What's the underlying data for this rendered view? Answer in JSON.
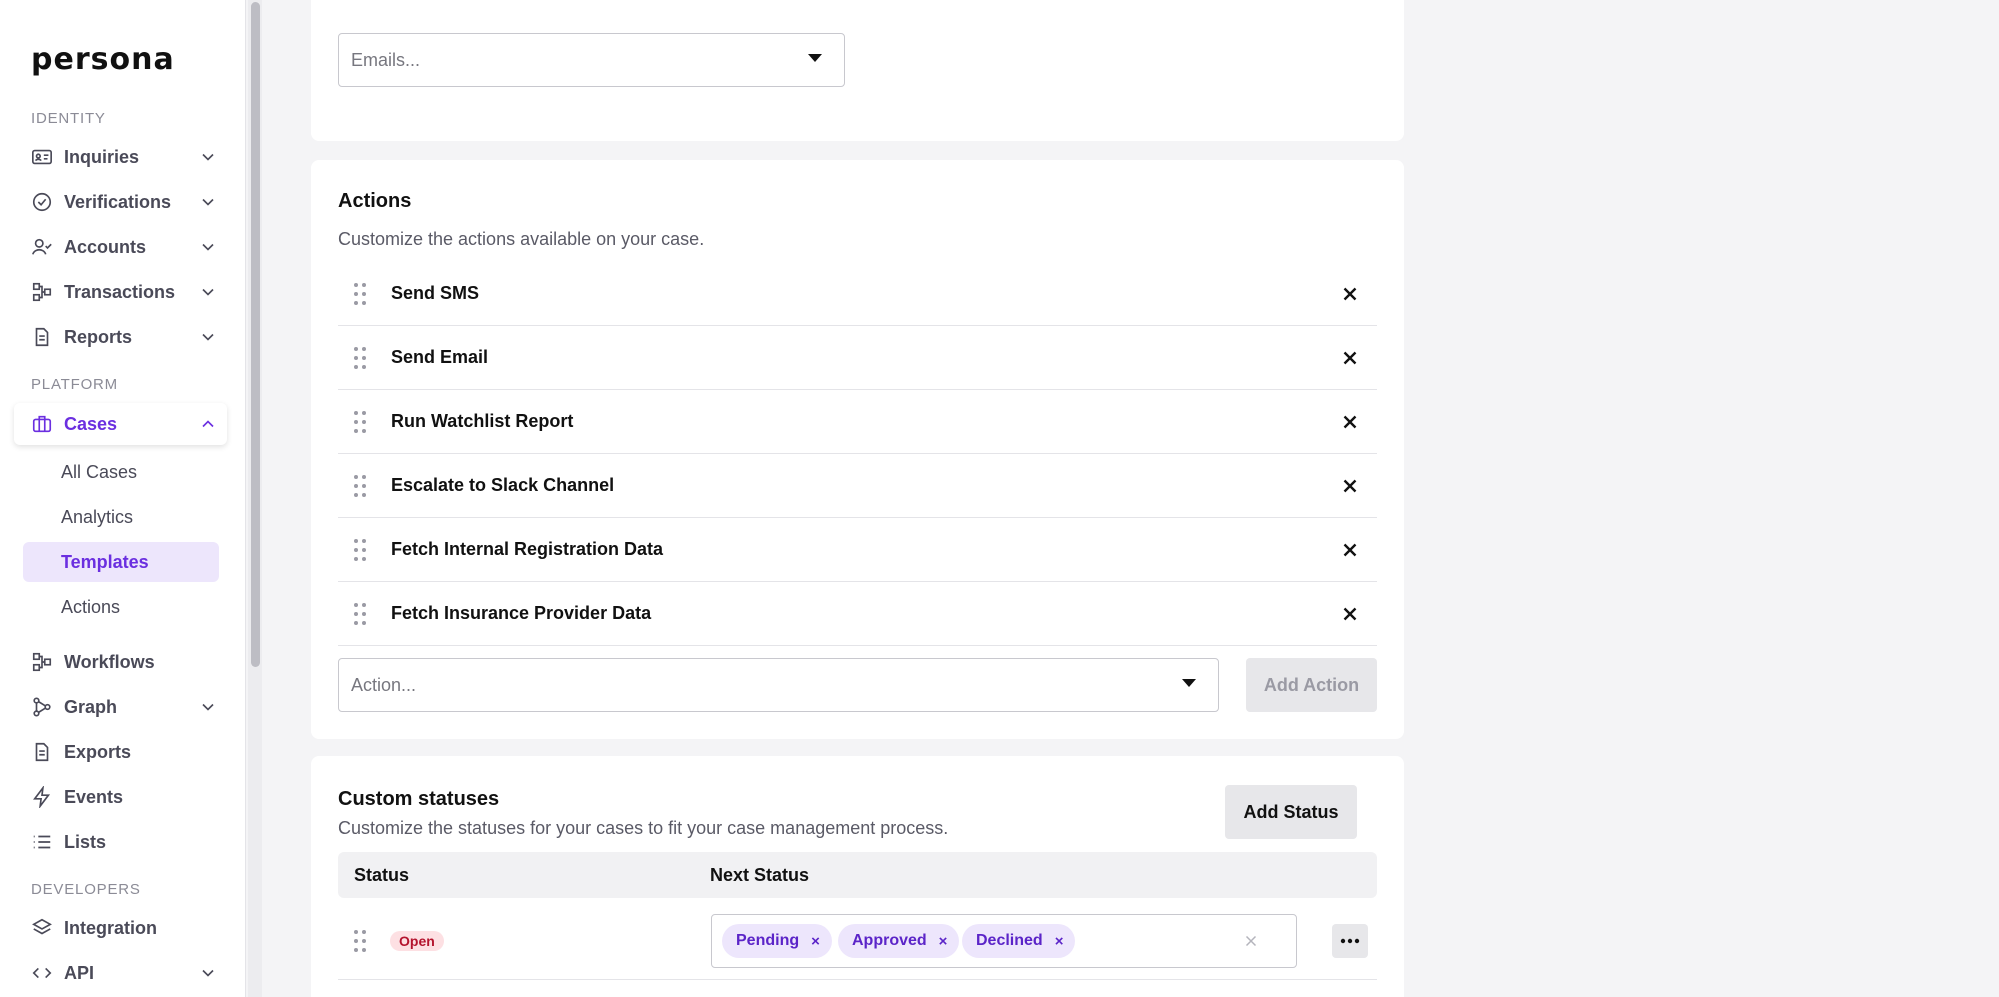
{
  "brand": {
    "logo_text": "persona"
  },
  "sidebar": {
    "sections": {
      "identity": "IDENTITY",
      "platform": "PLATFORM",
      "developers": "DEVELOPERS"
    },
    "items": {
      "inquiries": "Inquiries",
      "verifications": "Verifications",
      "accounts": "Accounts",
      "transactions": "Transactions",
      "reports": "Reports",
      "cases": "Cases",
      "workflows": "Workflows",
      "graph": "Graph",
      "exports": "Exports",
      "events": "Events",
      "lists": "Lists",
      "integration": "Integration",
      "api": "API"
    },
    "cases_sub": {
      "all_cases": "All Cases",
      "analytics": "Analytics",
      "templates": "Templates",
      "actions": "Actions"
    },
    "active_item": "Cases",
    "active_sub_item": "Templates",
    "accent_color": "#6b2fe0"
  },
  "emails_card": {
    "placeholder": "Emails..."
  },
  "actions_card": {
    "title": "Actions",
    "description": "Customize the actions available on your case.",
    "actions": [
      "Send SMS",
      "Send Email",
      "Run Watchlist Report",
      "Escalate to Slack Channel",
      "Fetch Internal Registration Data",
      "Fetch Insurance Provider Data"
    ],
    "action_select_placeholder": "Action...",
    "add_action_label": "Add Action"
  },
  "statuses_card": {
    "title": "Custom statuses",
    "description": "Customize the statuses for your cases to fit your case management process.",
    "add_status_label": "Add Status",
    "columns": {
      "status": "Status",
      "next_status": "Next Status"
    },
    "rows": [
      {
        "status": "Open",
        "next_statuses": [
          "Pending",
          "Approved",
          "Declined"
        ]
      }
    ],
    "tag_remove_glyph": "×"
  }
}
